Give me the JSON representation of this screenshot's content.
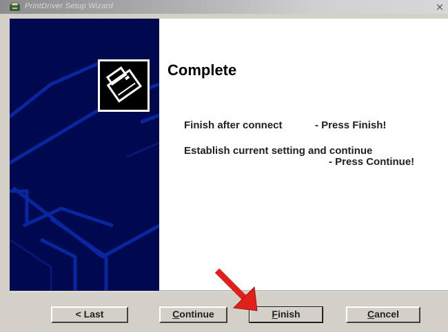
{
  "window": {
    "title": "PrintDriver Setup Wizard",
    "close_glyph": "×"
  },
  "heading": "Complete",
  "instructions": {
    "line1_left": "Finish after connect",
    "line1_right": "- Press Finish!",
    "line2_left": "Establish current setting and continue",
    "line2_right": "- Press Continue!"
  },
  "buttons": {
    "last": {
      "label": "< Last"
    },
    "continue": {
      "mnemonic": "C",
      "rest": "ontinue"
    },
    "finish": {
      "mnemonic": "F",
      "rest": "inish"
    },
    "cancel": {
      "mnemonic": "C",
      "rest": "ancel"
    }
  },
  "icons": {
    "title": "printer-setup-icon",
    "logo": "printer-logo-icon",
    "pointer": "red-arrow-icon"
  },
  "colors": {
    "panel_blue": "#000850",
    "panel_lines": "#0a2aa8",
    "arrow_red": "#e0201a",
    "dialog_gray": "#d4d0c8"
  }
}
